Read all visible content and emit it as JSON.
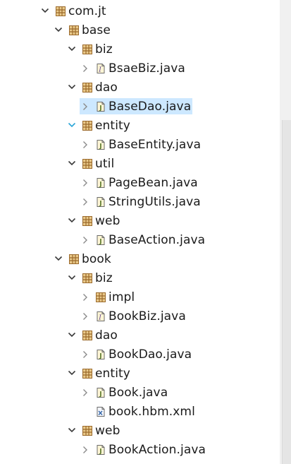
{
  "tree": [
    {
      "label": "com.jt",
      "icon": "package-icon",
      "state": "expanded",
      "depth": 0
    },
    {
      "label": "base",
      "icon": "package-icon",
      "state": "expanded",
      "depth": 1
    },
    {
      "label": "biz",
      "icon": "package-icon",
      "state": "expanded",
      "depth": 2
    },
    {
      "label": "BsaeBiz.java",
      "icon": "java-interface-icon",
      "state": "collapsed",
      "depth": 3
    },
    {
      "label": "dao",
      "icon": "package-icon",
      "state": "expanded",
      "depth": 2
    },
    {
      "label": "BaseDao.java",
      "icon": "java-file-icon",
      "state": "collapsed",
      "depth": 3,
      "selected": true
    },
    {
      "label": "entity",
      "icon": "package-icon",
      "state": "expanded",
      "depth": 2,
      "hover": true
    },
    {
      "label": "BaseEntity.java",
      "icon": "java-file-icon",
      "state": "collapsed",
      "depth": 3
    },
    {
      "label": "util",
      "icon": "package-icon",
      "state": "expanded",
      "depth": 2
    },
    {
      "label": "PageBean.java",
      "icon": "java-file-icon",
      "state": "collapsed",
      "depth": 3
    },
    {
      "label": "StringUtils.java",
      "icon": "java-file-icon",
      "state": "collapsed",
      "depth": 3
    },
    {
      "label": "web",
      "icon": "package-icon",
      "state": "expanded",
      "depth": 2
    },
    {
      "label": "BaseAction.java",
      "icon": "java-file-icon",
      "state": "collapsed",
      "depth": 3
    },
    {
      "label": "book",
      "icon": "package-icon",
      "state": "expanded",
      "depth": 1
    },
    {
      "label": "biz",
      "icon": "package-icon",
      "state": "expanded",
      "depth": 2
    },
    {
      "label": "impl",
      "icon": "package-icon",
      "state": "collapsed",
      "depth": 3
    },
    {
      "label": "BookBiz.java",
      "icon": "java-interface-icon",
      "state": "collapsed",
      "depth": 3
    },
    {
      "label": "dao",
      "icon": "package-icon",
      "state": "expanded",
      "depth": 2
    },
    {
      "label": "BookDao.java",
      "icon": "java-file-icon",
      "state": "collapsed",
      "depth": 3
    },
    {
      "label": "entity",
      "icon": "package-icon",
      "state": "expanded",
      "depth": 2
    },
    {
      "label": "Book.java",
      "icon": "java-file-icon",
      "state": "collapsed",
      "depth": 3
    },
    {
      "label": "book.hbm.xml",
      "icon": "xml-file-icon",
      "state": "leaf",
      "depth": 3
    },
    {
      "label": "web",
      "icon": "package-icon",
      "state": "expanded",
      "depth": 2
    },
    {
      "label": "BookAction.java",
      "icon": "java-file-icon",
      "state": "collapsed",
      "depth": 3
    }
  ],
  "colors": {
    "selection": "#cde8ff",
    "twisty": "#3a3a3a",
    "twisty_hover": "#2aa5d8",
    "package_brown": "#9b6a2c",
    "package_fill": "#e9c98a",
    "java_fill": "#fff6d6"
  }
}
